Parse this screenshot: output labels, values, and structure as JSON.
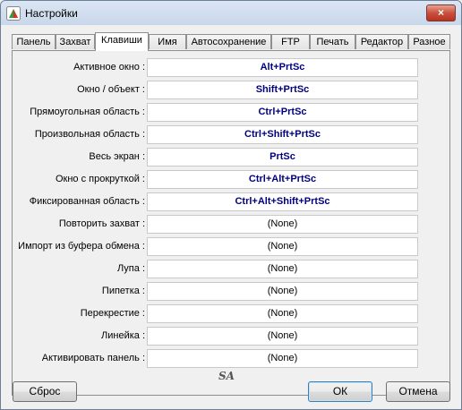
{
  "window": {
    "title": "Настройки",
    "close_glyph": "×"
  },
  "tabs": [
    {
      "label": "Панель"
    },
    {
      "label": "Захват"
    },
    {
      "label": "Клавиши",
      "active": true
    },
    {
      "label": "Имя"
    },
    {
      "label": "Автосохранение"
    },
    {
      "label": "FTP"
    },
    {
      "label": "Печать"
    },
    {
      "label": "Редактор"
    },
    {
      "label": "Разное"
    }
  ],
  "hotkeys": [
    {
      "label": "Активное окно :",
      "value": "Alt+PrtSc"
    },
    {
      "label": "Окно / объект :",
      "value": "Shift+PrtSc"
    },
    {
      "label": "Прямоугольная область :",
      "value": "Ctrl+PrtSc"
    },
    {
      "label": "Произвольная область :",
      "value": "Ctrl+Shift+PrtSc"
    },
    {
      "label": "Весь экран :",
      "value": "PrtSc"
    },
    {
      "label": "Окно с прокруткой :",
      "value": "Ctrl+Alt+PrtSc"
    },
    {
      "label": "Фиксированная область :",
      "value": "Ctrl+Alt+Shift+PrtSc"
    },
    {
      "label": "Повторить захват :",
      "value": "(None)"
    },
    {
      "label": "Импорт из буфера обмена :",
      "value": "(None)"
    },
    {
      "label": "Лупа :",
      "value": "(None)"
    },
    {
      "label": "Пипетка :",
      "value": "(None)"
    },
    {
      "label": "Перекрестие :",
      "value": "(None)"
    },
    {
      "label": "Линейка :",
      "value": "(None)"
    },
    {
      "label": "Активировать панель :",
      "value": "(None)"
    }
  ],
  "buttons": {
    "reset": "Сброс",
    "ok": "ОК",
    "cancel": "Отмена"
  },
  "footer_logo": "SA",
  "colors": {
    "hotkey_text": "#000080",
    "close_button": "#c9503f",
    "titlebar": "#c8d7ea"
  }
}
